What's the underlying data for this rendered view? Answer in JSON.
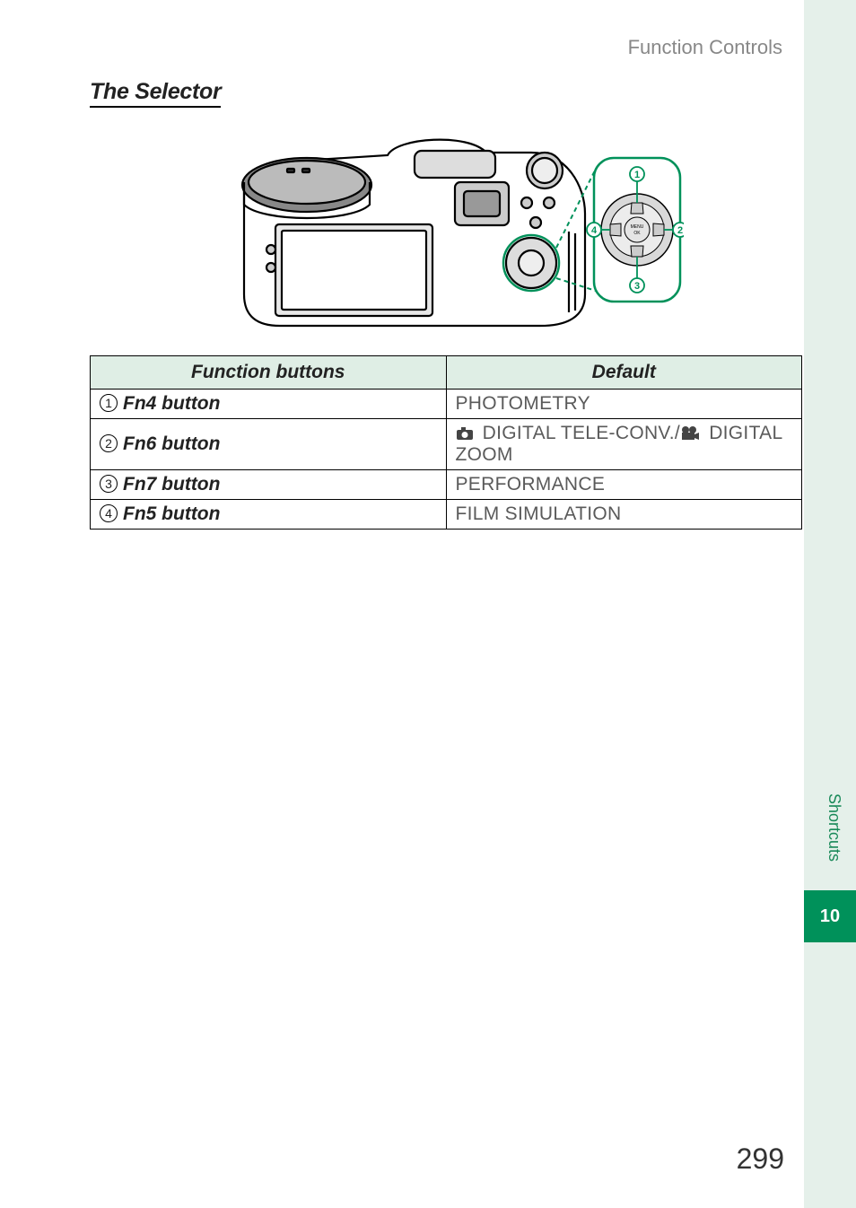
{
  "header": {
    "section": "Function Controls"
  },
  "title": "The Selector",
  "diagram": {
    "center_label_top": "MENU",
    "center_label_bottom": "OK",
    "callouts": [
      "1",
      "2",
      "3",
      "4"
    ]
  },
  "table": {
    "headers": [
      "Function buttons",
      "Default"
    ],
    "rows": [
      {
        "num": "1",
        "label": "Fn4 button",
        "default_type": "text",
        "default": "PHOTOMETRY"
      },
      {
        "num": "2",
        "label": "Fn6 button",
        "default_type": "icons",
        "default_pre": "DIGITAL TELE-CONV./",
        "default_post": "DIGITAL ZOOM"
      },
      {
        "num": "3",
        "label": "Fn7 button",
        "default_type": "text",
        "default": "PERFORMANCE"
      },
      {
        "num": "4",
        "label": "Fn5 button",
        "default_type": "text",
        "default": "FILM SIMULATION"
      }
    ]
  },
  "sidebar": {
    "label": "Shortcuts",
    "chapter": "10"
  },
  "page_number": "299"
}
